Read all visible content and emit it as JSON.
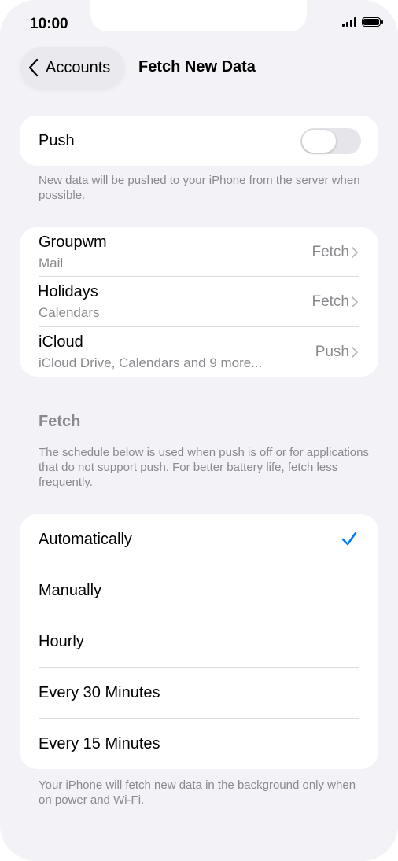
{
  "status_bar": {
    "time": "10:00"
  },
  "nav": {
    "back_label": "Accounts",
    "title": "Fetch New Data"
  },
  "push": {
    "label": "Push",
    "enabled": false,
    "note": "New data will be pushed to your iPhone from the server when possible."
  },
  "accounts": [
    {
      "name": "Groupwm",
      "detail": "Mail",
      "value": "Fetch"
    },
    {
      "name": "Holidays",
      "detail": "Calendars",
      "value": "Fetch"
    },
    {
      "name": "iCloud",
      "detail": "iCloud Drive, Calendars and 9 more...",
      "value": "Push"
    }
  ],
  "fetch": {
    "title": "Fetch",
    "note": "The schedule below is used when push is off or for applications that do not support push. For better battery life, fetch less frequently.",
    "options": [
      "Automatically",
      "Manually",
      "Hourly",
      "Every 30 Minutes",
      "Every 15 Minutes"
    ],
    "selected": "Automatically",
    "footer": "Your iPhone will fetch new data in the background only when on power and Wi-Fi."
  },
  "colors": {
    "accent": "#007aff",
    "background": "#f2f2f7",
    "secondary_text": "#8a8a8e"
  }
}
